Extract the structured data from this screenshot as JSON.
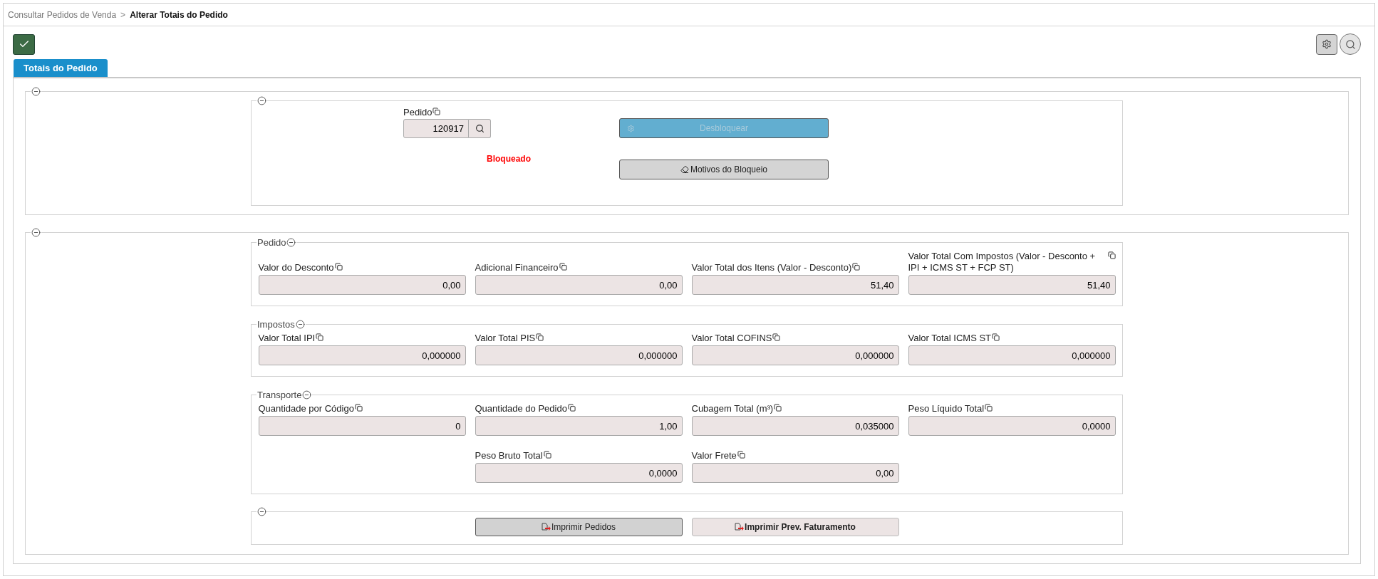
{
  "breadcrumb": [
    {
      "label": "Consultar Pedidos de Venda",
      "current": false
    },
    {
      "label": "Alterar Totais do Pedido",
      "current": true
    }
  ],
  "breadcrumb_separator": ">",
  "tabs": [
    {
      "label": "Totais do Pedido",
      "selected": true
    }
  ],
  "header_section": {
    "expanded": true,
    "inner_expanded": true,
    "pedido": {
      "label": "Pedido",
      "value": "120917",
      "disabled": true
    },
    "status": "Bloqueado",
    "unlock_button": {
      "label": "Desbloquear",
      "disabled": true
    },
    "reasons_button": {
      "label": "Motivos do Bloqueio",
      "disabled": false
    }
  },
  "totals_section": {
    "expanded": true,
    "groups": [
      {
        "title": "Pedido",
        "expanded": true,
        "rows": [
          [
            {
              "label": "Valor do Desconto",
              "value": "0,00",
              "disabled": true
            },
            {
              "label": "Adicional Financeiro",
              "value": "0,00",
              "disabled": true
            },
            {
              "label": "Valor Total dos Itens (Valor - Desconto)",
              "value": "51,40",
              "disabled": true
            },
            {
              "label": "Valor Total Com Impostos (Valor - Desconto + IPI + ICMS ST + FCP ST)",
              "value": "51,40",
              "disabled": true
            }
          ]
        ]
      },
      {
        "title": "Impostos",
        "expanded": true,
        "rows": [
          [
            {
              "label": "Valor Total IPI",
              "value": "0,000000",
              "disabled": true
            },
            {
              "label": "Valor Total PIS",
              "value": "0,000000",
              "disabled": true
            },
            {
              "label": "Valor Total COFINS",
              "value": "0,000000",
              "disabled": true
            },
            {
              "label": "Valor Total ICMS ST",
              "value": "0,000000",
              "disabled": true
            }
          ]
        ]
      },
      {
        "title": "Transporte",
        "expanded": true,
        "rows": [
          [
            {
              "label": "Quantidade por Código",
              "value": "0",
              "disabled": true
            },
            {
              "label": "Quantidade do Pedido",
              "value": "1,00",
              "disabled": true
            },
            {
              "label": "Cubagem Total (m³)",
              "value": "0,035000",
              "disabled": true
            },
            {
              "label": "Peso Líquido Total",
              "value": "0,0000",
              "disabled": true
            }
          ],
          [
            null,
            {
              "label": "Peso Bruto Total",
              "value": "0,0000",
              "disabled": true
            },
            {
              "label": "Valor Frete",
              "value": "0,00",
              "disabled": true
            }
          ]
        ]
      }
    ],
    "print_group": {
      "expanded": true,
      "buttons": [
        {
          "label": "Imprimir Pedidos",
          "focused": true
        },
        {
          "label": "Imprimir Prev. Faturamento",
          "focused": false
        }
      ]
    }
  }
}
